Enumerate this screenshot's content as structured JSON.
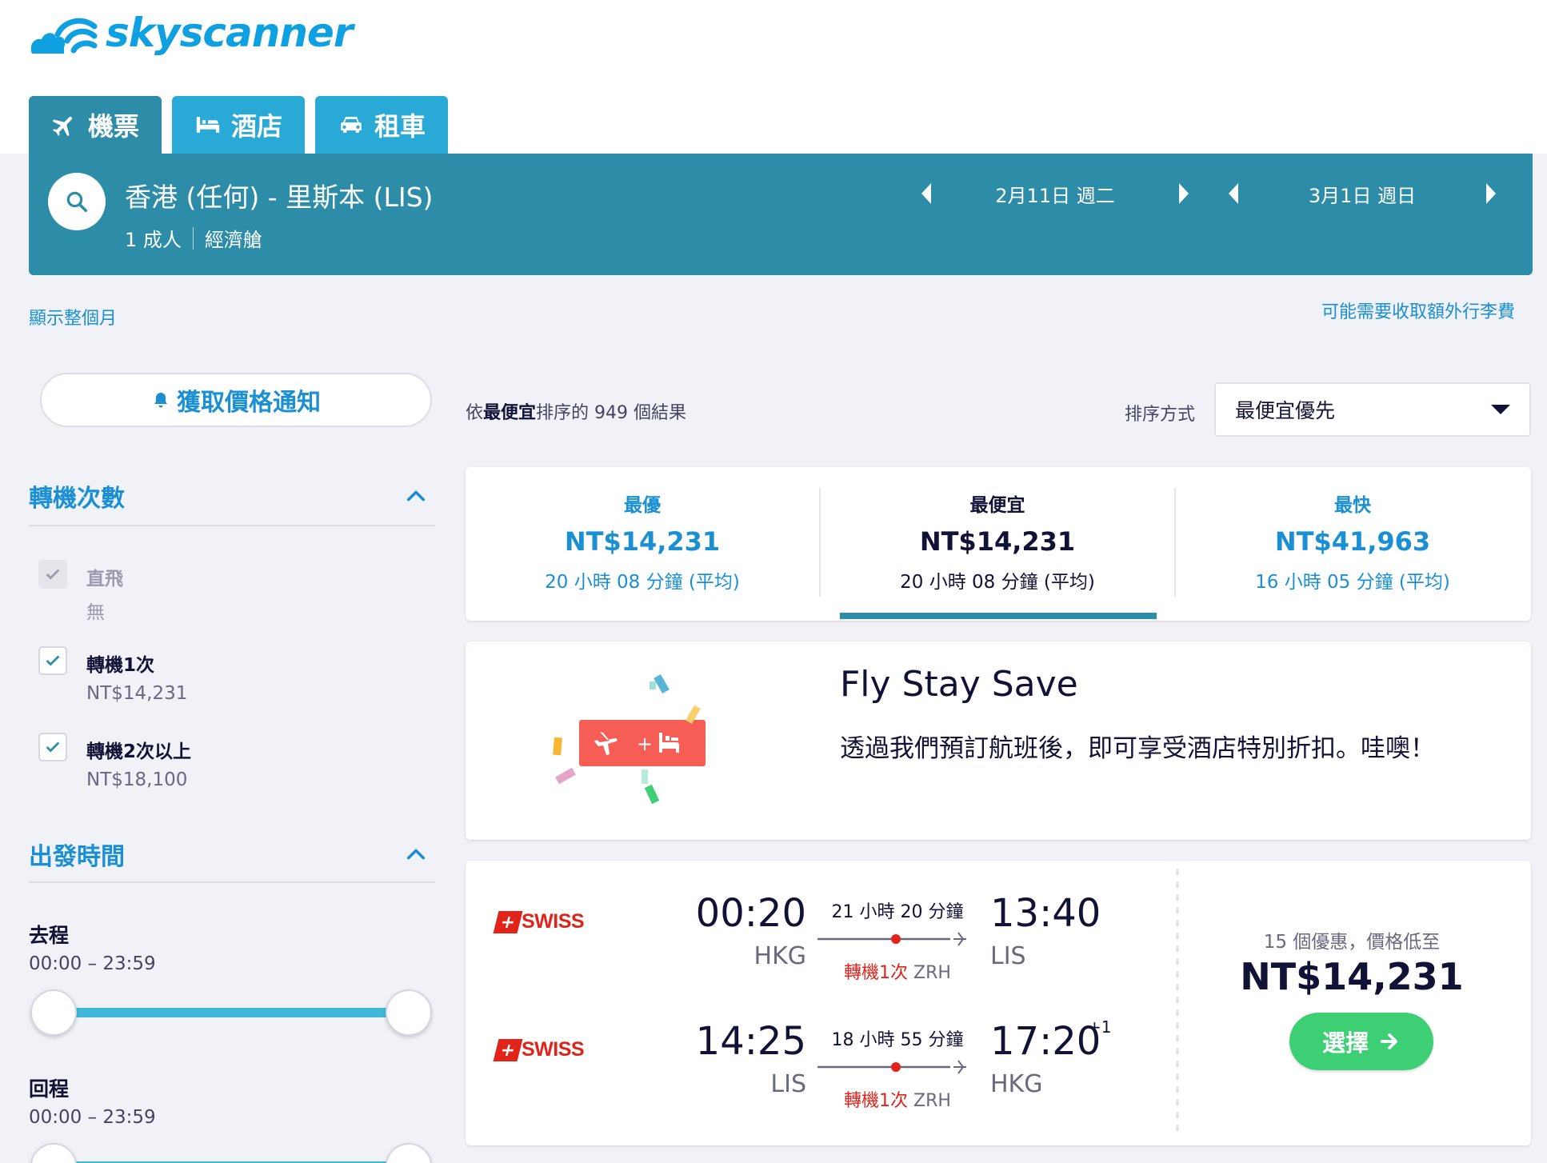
{
  "brand": {
    "name": "skyscanner",
    "color": "#0ea0e0"
  },
  "tabs": [
    {
      "label": "機票",
      "icon": "plane-icon"
    },
    {
      "label": "酒店",
      "icon": "bed-icon"
    },
    {
      "label": "租車",
      "icon": "car-icon"
    }
  ],
  "search": {
    "route": "香港 (任何) - 里斯本 (LIS)",
    "passengers": "1 成人",
    "cabin": "經濟艙",
    "depart_date": "2月11日 週二",
    "return_date": "3月1日 週日"
  },
  "links": {
    "show_month": "顯示整個月",
    "baggage_fees": "可能需要收取額外行李費"
  },
  "price_alert_label": "獲取價格通知",
  "results": {
    "prefix": "依",
    "sort_bold": "最便宜",
    "suffix": "排序的 949 個結果"
  },
  "sort": {
    "label": "排序方式",
    "selected": "最便宜優先"
  },
  "filters": {
    "stops": {
      "title": "轉機次數",
      "options": [
        {
          "label": "直飛",
          "sub": "無",
          "checked": true,
          "disabled": true
        },
        {
          "label": "轉機1次",
          "sub": "NT$14,231",
          "checked": true,
          "disabled": false
        },
        {
          "label": "轉機2次以上",
          "sub": "NT$18,100",
          "checked": true,
          "disabled": false
        }
      ]
    },
    "departure_times": {
      "title": "出發時間",
      "outbound_label": "去程",
      "outbound_range": "00:00 – 23:59",
      "return_label": "回程",
      "return_range": "00:00 – 23:59"
    }
  },
  "summary_tabs": [
    {
      "title": "最優",
      "price": "NT$14,231",
      "duration": "20 小時 08 分鐘 (平均)"
    },
    {
      "title": "最便宜",
      "price": "NT$14,231",
      "duration": "20 小時 08 分鐘 (平均)",
      "selected": true
    },
    {
      "title": "最快",
      "price": "NT$41,963",
      "duration": "16 小時 05 分鐘 (平均)"
    }
  ],
  "promo": {
    "title": "Fly Stay Save",
    "text": "透過我們預訂航班後，即可享受酒店特別折扣。哇噢！"
  },
  "flight": {
    "legs": [
      {
        "airline": "SWISS",
        "depart_time": "00:20",
        "depart_airport": "HKG",
        "duration": "21 小時 20 分鐘",
        "stops": "轉機1次",
        "via": "ZRH",
        "arrive_time": "13:40",
        "arrive_airport": "LIS",
        "day_offset": ""
      },
      {
        "airline": "SWISS",
        "depart_time": "14:25",
        "depart_airport": "LIS",
        "duration": "18 小時 55 分鐘",
        "stops": "轉機1次",
        "via": "ZRH",
        "arrive_time": "17:20",
        "arrive_airport": "HKG",
        "day_offset": "+1"
      }
    ],
    "deals": "15 個優惠，價格低至",
    "price": "NT$14,231",
    "select_label": "選擇"
  },
  "colors": {
    "accent": "#2d8da9",
    "tab": "#28a9d6",
    "link": "#1a8fd4",
    "cta": "#3ccf74",
    "swiss_red": "#e2231a"
  }
}
